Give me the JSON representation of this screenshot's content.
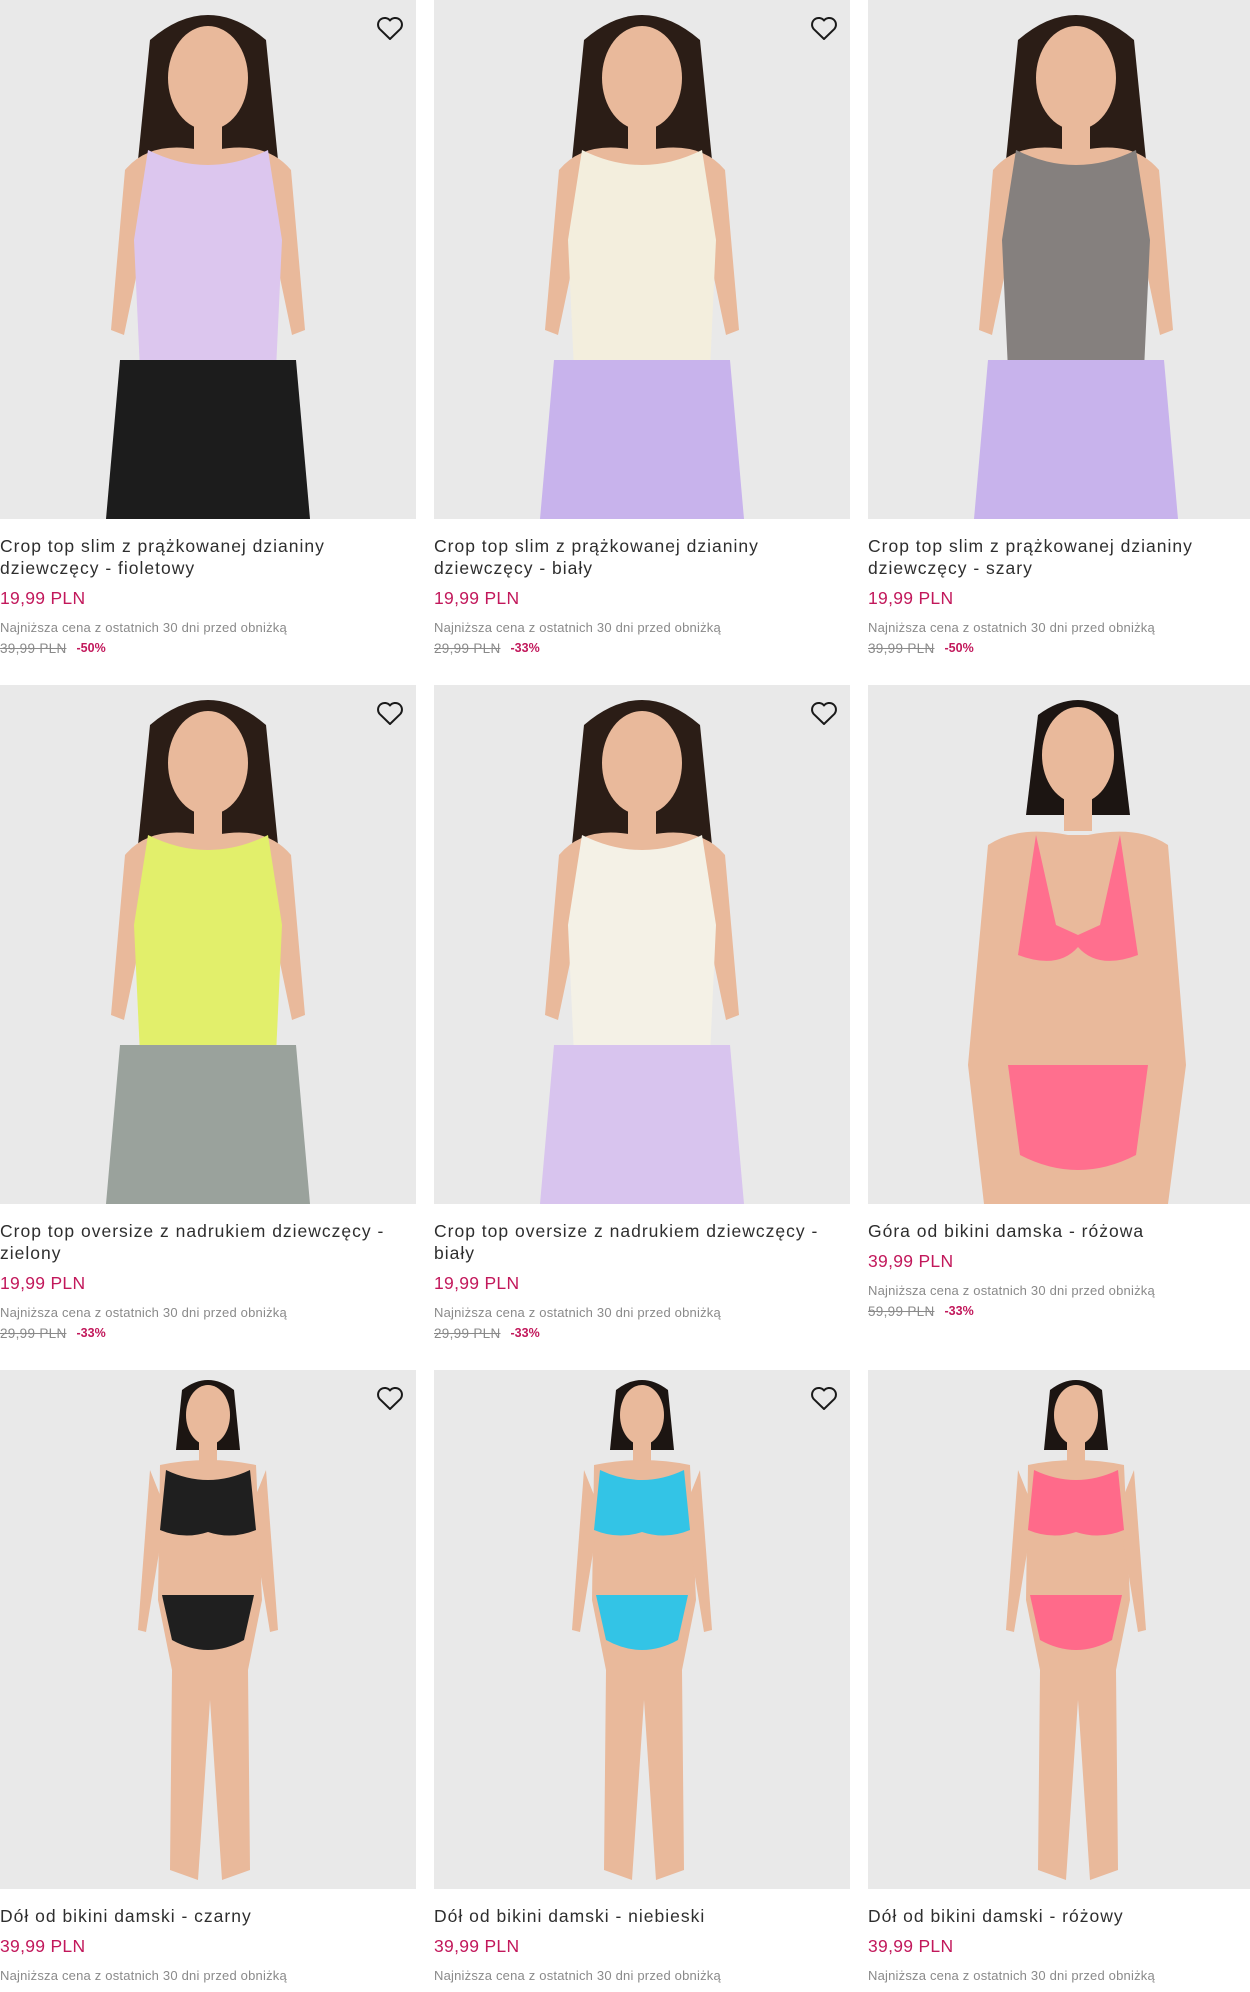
{
  "price_color": "#c2185b",
  "products": [
    {
      "name": "Crop top slim z prążkowanej dzianiny dziewczęcy - fioletowy",
      "price": "19,99 PLN",
      "lowest_label": "Najniższa cena z ostatnich 30 dni przed obniżką",
      "old_price": "39,99 PLN",
      "discount": "-50%",
      "top_color": "#dcc6ee",
      "bottom_color": "#1c1c1c",
      "figure": "girl"
    },
    {
      "name": "Crop top slim z prążkowanej dzianiny dziewczęcy - biały",
      "price": "19,99 PLN",
      "lowest_label": "Najniższa cena z ostatnich 30 dni przed obniżką",
      "old_price": "29,99 PLN",
      "discount": "-33%",
      "top_color": "#f3eedd",
      "bottom_color": "#c8b3ec",
      "figure": "girl"
    },
    {
      "name": "Crop top slim z prążkowanej dzianiny dziewczęcy - szary",
      "price": "19,99 PLN",
      "lowest_label": "Najniższa cena z ostatnich 30 dni przed obniżką",
      "old_price": "39,99 PLN",
      "discount": "-50%",
      "top_color": "#85807e",
      "bottom_color": "#c8b3ec",
      "figure": "girl"
    },
    {
      "name": "Crop top oversize z nadrukiem dziewczęcy - zielony",
      "price": "19,99 PLN",
      "lowest_label": "Najniższa cena z ostatnich 30 dni przed obniżką",
      "old_price": "29,99 PLN",
      "discount": "-33%",
      "top_color": "#e2ef6b",
      "bottom_color": "#9aa29c",
      "figure": "girl"
    },
    {
      "name": "Crop top oversize z nadrukiem dziewczęcy - biały",
      "price": "19,99 PLN",
      "lowest_label": "Najniższa cena z ostatnich 30 dni przed obniżką",
      "old_price": "29,99 PLN",
      "discount": "-33%",
      "top_color": "#f4f1e6",
      "bottom_color": "#d8c4ee",
      "figure": "girl"
    },
    {
      "name": "Góra od bikini damska - różowa",
      "price": "39,99 PLN",
      "lowest_label": "Najniższa cena z ostatnich 30 dni przed obniżką",
      "old_price": "59,99 PLN",
      "discount": "-33%",
      "top_color": "#ff6f8e",
      "bottom_color": "#ff6f8e",
      "figure": "woman-close"
    },
    {
      "name": "Dół od bikini damski - czarny",
      "price": "39,99 PLN",
      "lowest_label": "Najniższa cena z ostatnich 30 dni przed obniżką",
      "old_price": "",
      "discount": "",
      "top_color": "#1f1f1f",
      "bottom_color": "#1f1f1f",
      "figure": "woman-full"
    },
    {
      "name": "Dół od bikini damski - niebieski",
      "price": "39,99 PLN",
      "lowest_label": "Najniższa cena z ostatnich 30 dni przed obniżką",
      "old_price": "",
      "discount": "",
      "top_color": "#33c4e6",
      "bottom_color": "#33c4e6",
      "figure": "woman-full"
    },
    {
      "name": "Dół od bikini damski - różowy",
      "price": "39,99 PLN",
      "lowest_label": "Najniższa cena z ostatnich 30 dni przed obniżką",
      "old_price": "",
      "discount": "",
      "top_color": "#ff6a8a",
      "bottom_color": "#ff6a8a",
      "figure": "woman-full"
    }
  ]
}
